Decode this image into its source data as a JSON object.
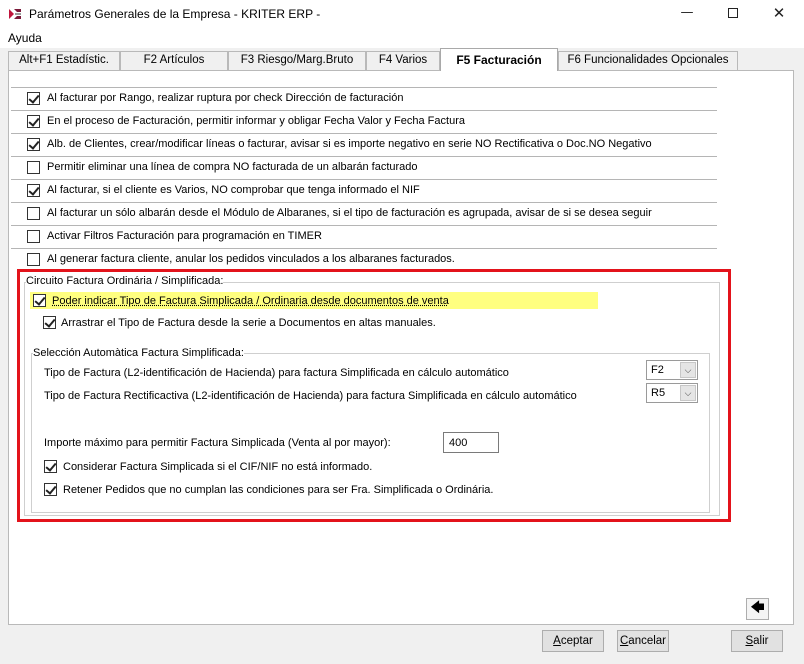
{
  "window": {
    "title": "Parámetros Generales de la Empresa - KRITER ERP -",
    "minimize_glyph": "—",
    "close_glyph": "✕"
  },
  "menu": {
    "items": [
      "Ayuda"
    ]
  },
  "tabs": [
    {
      "label": "Alt+F1 Estadístic."
    },
    {
      "label": "F2 Artículos"
    },
    {
      "label": "F3 Riesgo/Marg.Bruto"
    },
    {
      "label": "F4 Varios"
    },
    {
      "label": "F5 Facturación",
      "active": true
    },
    {
      "label": "F6 Funcionalidades Opcionales"
    }
  ],
  "options": [
    {
      "label": "Al facturar por Rango, realizar ruptura por check Dirección de facturación",
      "checked": true
    },
    {
      "label": "En el proceso de Facturación, permitir informar y obligar Fecha Valor y Fecha Factura",
      "checked": true
    },
    {
      "label": "Alb. de Clientes, crear/modificar líneas o facturar, avisar si es importe negativo en serie NO Rectificativa o Doc.NO Negativo",
      "checked": true
    },
    {
      "label": "Permitir eliminar una línea de compra NO facturada de un albarán facturado",
      "checked": false
    },
    {
      "label": "Al facturar, si el cliente es Varios, NO comprobar que tenga informado el NIF",
      "checked": true
    },
    {
      "label": "Al facturar un sólo albarán desde el Módulo de Albaranes, si el tipo de facturación es agrupada, avisar de si se desea seguir",
      "checked": false
    },
    {
      "label": "Activar Filtros Facturación para programación en TIMER",
      "checked": false
    },
    {
      "label": "Al generar factura cliente, anular los pedidos vinculados a los albaranes facturados.",
      "checked": false
    }
  ],
  "circuito": {
    "title": "Circuito Factura Ordinária / Simplificada:",
    "poder_indicar": {
      "label": "Poder indicar Tipo de Factura Simplicada / Ordinaria desde documentos de venta",
      "checked": true
    },
    "arrastrar": {
      "label": "Arrastrar el Tipo de Factura desde la serie a Documentos en altas manuales.",
      "checked": true
    },
    "seleccion": {
      "title": "Selección Automàtica Factura Simplificada:",
      "tipo_factura_label": "Tipo de Factura (L2-identificación de Hacienda) para factura Simplificada en cálculo automático",
      "tipo_factura_value": "F2",
      "tipo_rect_label": "Tipo de Factura Rectificactiva (L2-identificación de Hacienda) para factura Simplificada en cálculo automático",
      "tipo_rect_value": "R5",
      "importe_label": "Importe máximo para permitir Factura Simplicada (Venta al por mayor):",
      "importe_value": "400",
      "considerar": {
        "label": "Considerar Factura Simplicada si el CIF/NIF no está informado.",
        "checked": true
      },
      "retener": {
        "label": "Retener Pedidos que no cumplan las condiciones para ser Fra. Simplificada o Ordinária.",
        "checked": true
      }
    }
  },
  "buttons": {
    "nav_glyph": "🡄",
    "accept_first": "A",
    "accept_rest": "ceptar",
    "cancel_first": "C",
    "cancel_rest": "ancelar",
    "exit_first": "S",
    "exit_rest": "alir"
  },
  "colors": {
    "highlight": "#ffff80",
    "frame": "#e3131b"
  }
}
